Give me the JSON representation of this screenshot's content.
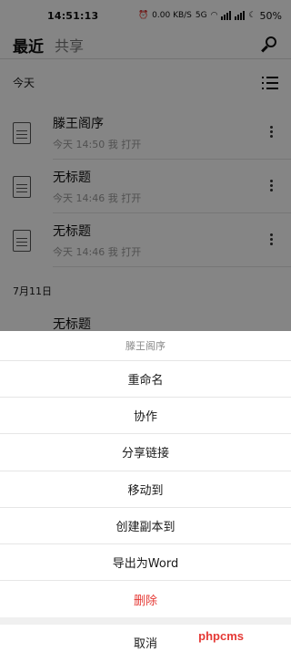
{
  "status_bar": {
    "time": "14:51:13",
    "net_speed": "0.00 KB/S",
    "network": "5G",
    "battery": "50%"
  },
  "header": {
    "tab_recent": "最近",
    "tab_shared": "共享"
  },
  "today_section": {
    "label": "今天"
  },
  "files": [
    {
      "name": "滕王阁序",
      "meta": "今天 14:50 我 打开"
    },
    {
      "name": "无标题",
      "meta": "今天 14:46 我 打开"
    },
    {
      "name": "无标题",
      "meta": "今天 14:46 我 打开"
    }
  ],
  "date_section": {
    "label": "7月11日"
  },
  "partial_file": {
    "name": "无标题"
  },
  "sheet": {
    "title": "滕王阁序",
    "items": [
      "重命名",
      "协作",
      "分享链接",
      "移动到",
      "创建副本到",
      "导出为Word"
    ],
    "delete_label": "删除",
    "cancel_label": "取消"
  },
  "watermark": "phpcms",
  "colors": {
    "danger": "#e53935",
    "overlay": "rgba(0,0,0,0.48)"
  }
}
